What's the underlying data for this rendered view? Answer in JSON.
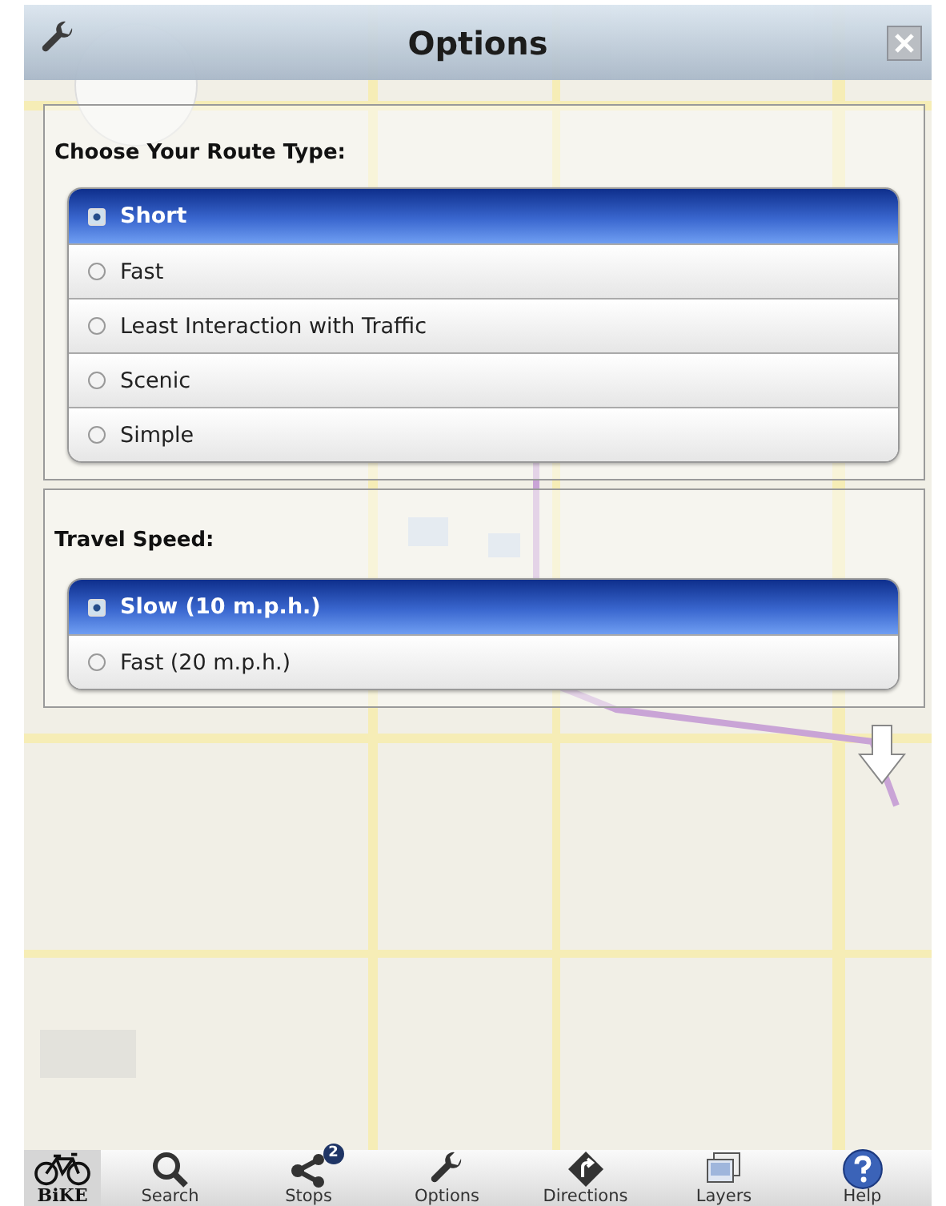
{
  "top_bar": {
    "title": "Options"
  },
  "sections": [
    {
      "label": "Choose Your Route Type:",
      "options": [
        {
          "label": "Short",
          "selected": true
        },
        {
          "label": "Fast",
          "selected": false
        },
        {
          "label": "Least Interaction with Traffic",
          "selected": false
        },
        {
          "label": "Scenic",
          "selected": false
        },
        {
          "label": "Simple",
          "selected": false
        }
      ]
    },
    {
      "label": "Travel Speed:",
      "options": [
        {
          "label": "Slow (10 m.p.h.)",
          "selected": true
        },
        {
          "label": "Fast (20 m.p.h.)",
          "selected": false
        }
      ]
    }
  ],
  "toolbar": {
    "logo_text": "BiKE",
    "items": [
      {
        "kind": "search",
        "label": "Search"
      },
      {
        "kind": "stops",
        "label": "Stops",
        "badge": "2"
      },
      {
        "kind": "options",
        "label": "Options"
      },
      {
        "kind": "directions",
        "label": "Directions"
      },
      {
        "kind": "layers",
        "label": "Layers"
      },
      {
        "kind": "help",
        "label": "Help"
      }
    ]
  }
}
